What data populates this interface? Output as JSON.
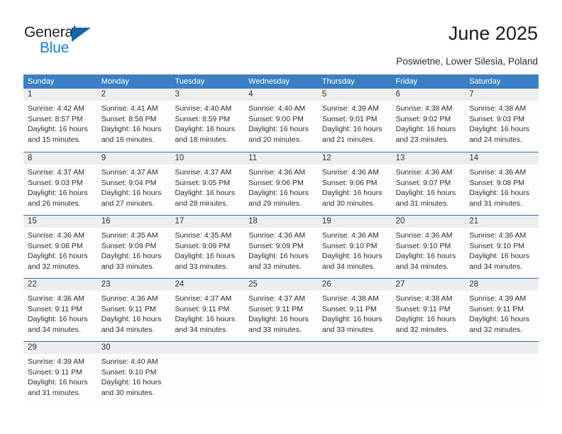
{
  "brand": {
    "name_top": "General",
    "name_bottom": "Blue",
    "color_dark": "#231f20",
    "color_blue": "#1a7fd4",
    "triangle_color": "#1565a8"
  },
  "header": {
    "title": "June 2025",
    "location": "Poswietne, Lower Silesia, Poland"
  },
  "theme": {
    "header_bg": "#3b7fc4",
    "week_divider": "#2b6cad",
    "daynum_band": "#eeeeee",
    "text": "#2b2b2b"
  },
  "weekdays": [
    "Sunday",
    "Monday",
    "Tuesday",
    "Wednesday",
    "Thursday",
    "Friday",
    "Saturday"
  ],
  "weeks": [
    [
      {
        "day": "1",
        "sunrise": "Sunrise: 4:42 AM",
        "sunset": "Sunset: 8:57 PM",
        "daylight1": "Daylight: 16 hours",
        "daylight2": "and 15 minutes."
      },
      {
        "day": "2",
        "sunrise": "Sunrise: 4:41 AM",
        "sunset": "Sunset: 8:58 PM",
        "daylight1": "Daylight: 16 hours",
        "daylight2": "and 16 minutes."
      },
      {
        "day": "3",
        "sunrise": "Sunrise: 4:40 AM",
        "sunset": "Sunset: 8:59 PM",
        "daylight1": "Daylight: 16 hours",
        "daylight2": "and 18 minutes."
      },
      {
        "day": "4",
        "sunrise": "Sunrise: 4:40 AM",
        "sunset": "Sunset: 9:00 PM",
        "daylight1": "Daylight: 16 hours",
        "daylight2": "and 20 minutes."
      },
      {
        "day": "5",
        "sunrise": "Sunrise: 4:39 AM",
        "sunset": "Sunset: 9:01 PM",
        "daylight1": "Daylight: 16 hours",
        "daylight2": "and 21 minutes."
      },
      {
        "day": "6",
        "sunrise": "Sunrise: 4:38 AM",
        "sunset": "Sunset: 9:02 PM",
        "daylight1": "Daylight: 16 hours",
        "daylight2": "and 23 minutes."
      },
      {
        "day": "7",
        "sunrise": "Sunrise: 4:38 AM",
        "sunset": "Sunset: 9:03 PM",
        "daylight1": "Daylight: 16 hours",
        "daylight2": "and 24 minutes."
      }
    ],
    [
      {
        "day": "8",
        "sunrise": "Sunrise: 4:37 AM",
        "sunset": "Sunset: 9:03 PM",
        "daylight1": "Daylight: 16 hours",
        "daylight2": "and 26 minutes."
      },
      {
        "day": "9",
        "sunrise": "Sunrise: 4:37 AM",
        "sunset": "Sunset: 9:04 PM",
        "daylight1": "Daylight: 16 hours",
        "daylight2": "and 27 minutes."
      },
      {
        "day": "10",
        "sunrise": "Sunrise: 4:37 AM",
        "sunset": "Sunset: 9:05 PM",
        "daylight1": "Daylight: 16 hours",
        "daylight2": "and 28 minutes."
      },
      {
        "day": "11",
        "sunrise": "Sunrise: 4:36 AM",
        "sunset": "Sunset: 9:06 PM",
        "daylight1": "Daylight: 16 hours",
        "daylight2": "and 29 minutes."
      },
      {
        "day": "12",
        "sunrise": "Sunrise: 4:36 AM",
        "sunset": "Sunset: 9:06 PM",
        "daylight1": "Daylight: 16 hours",
        "daylight2": "and 30 minutes."
      },
      {
        "day": "13",
        "sunrise": "Sunrise: 4:36 AM",
        "sunset": "Sunset: 9:07 PM",
        "daylight1": "Daylight: 16 hours",
        "daylight2": "and 31 minutes."
      },
      {
        "day": "14",
        "sunrise": "Sunrise: 4:36 AM",
        "sunset": "Sunset: 9:08 PM",
        "daylight1": "Daylight: 16 hours",
        "daylight2": "and 31 minutes."
      }
    ],
    [
      {
        "day": "15",
        "sunrise": "Sunrise: 4:36 AM",
        "sunset": "Sunset: 9:08 PM",
        "daylight1": "Daylight: 16 hours",
        "daylight2": "and 32 minutes."
      },
      {
        "day": "16",
        "sunrise": "Sunrise: 4:35 AM",
        "sunset": "Sunset: 9:09 PM",
        "daylight1": "Daylight: 16 hours",
        "daylight2": "and 33 minutes."
      },
      {
        "day": "17",
        "sunrise": "Sunrise: 4:35 AM",
        "sunset": "Sunset: 9:09 PM",
        "daylight1": "Daylight: 16 hours",
        "daylight2": "and 33 minutes."
      },
      {
        "day": "18",
        "sunrise": "Sunrise: 4:36 AM",
        "sunset": "Sunset: 9:09 PM",
        "daylight1": "Daylight: 16 hours",
        "daylight2": "and 33 minutes."
      },
      {
        "day": "19",
        "sunrise": "Sunrise: 4:36 AM",
        "sunset": "Sunset: 9:10 PM",
        "daylight1": "Daylight: 16 hours",
        "daylight2": "and 34 minutes."
      },
      {
        "day": "20",
        "sunrise": "Sunrise: 4:36 AM",
        "sunset": "Sunset: 9:10 PM",
        "daylight1": "Daylight: 16 hours",
        "daylight2": "and 34 minutes."
      },
      {
        "day": "21",
        "sunrise": "Sunrise: 4:36 AM",
        "sunset": "Sunset: 9:10 PM",
        "daylight1": "Daylight: 16 hours",
        "daylight2": "and 34 minutes."
      }
    ],
    [
      {
        "day": "22",
        "sunrise": "Sunrise: 4:36 AM",
        "sunset": "Sunset: 9:11 PM",
        "daylight1": "Daylight: 16 hours",
        "daylight2": "and 34 minutes."
      },
      {
        "day": "23",
        "sunrise": "Sunrise: 4:36 AM",
        "sunset": "Sunset: 9:11 PM",
        "daylight1": "Daylight: 16 hours",
        "daylight2": "and 34 minutes."
      },
      {
        "day": "24",
        "sunrise": "Sunrise: 4:37 AM",
        "sunset": "Sunset: 9:11 PM",
        "daylight1": "Daylight: 16 hours",
        "daylight2": "and 34 minutes."
      },
      {
        "day": "25",
        "sunrise": "Sunrise: 4:37 AM",
        "sunset": "Sunset: 9:11 PM",
        "daylight1": "Daylight: 16 hours",
        "daylight2": "and 33 minutes."
      },
      {
        "day": "26",
        "sunrise": "Sunrise: 4:38 AM",
        "sunset": "Sunset: 9:11 PM",
        "daylight1": "Daylight: 16 hours",
        "daylight2": "and 33 minutes."
      },
      {
        "day": "27",
        "sunrise": "Sunrise: 4:38 AM",
        "sunset": "Sunset: 9:11 PM",
        "daylight1": "Daylight: 16 hours",
        "daylight2": "and 32 minutes."
      },
      {
        "day": "28",
        "sunrise": "Sunrise: 4:39 AM",
        "sunset": "Sunset: 9:11 PM",
        "daylight1": "Daylight: 16 hours",
        "daylight2": "and 32 minutes."
      }
    ],
    [
      {
        "day": "29",
        "sunrise": "Sunrise: 4:39 AM",
        "sunset": "Sunset: 9:11 PM",
        "daylight1": "Daylight: 16 hours",
        "daylight2": "and 31 minutes."
      },
      {
        "day": "30",
        "sunrise": "Sunrise: 4:40 AM",
        "sunset": "Sunset: 9:10 PM",
        "daylight1": "Daylight: 16 hours",
        "daylight2": "and 30 minutes."
      },
      {
        "day": "",
        "sunrise": "",
        "sunset": "",
        "daylight1": "",
        "daylight2": ""
      },
      {
        "day": "",
        "sunrise": "",
        "sunset": "",
        "daylight1": "",
        "daylight2": ""
      },
      {
        "day": "",
        "sunrise": "",
        "sunset": "",
        "daylight1": "",
        "daylight2": ""
      },
      {
        "day": "",
        "sunrise": "",
        "sunset": "",
        "daylight1": "",
        "daylight2": ""
      },
      {
        "day": "",
        "sunrise": "",
        "sunset": "",
        "daylight1": "",
        "daylight2": ""
      }
    ]
  ]
}
